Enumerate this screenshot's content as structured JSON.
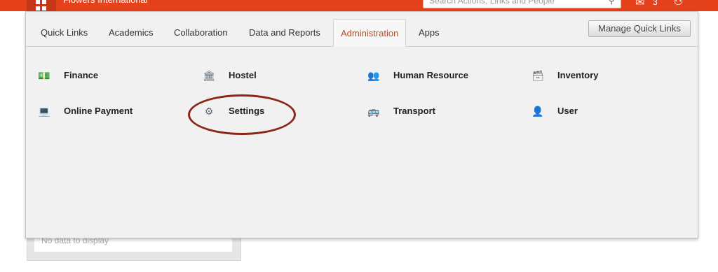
{
  "header": {
    "school_name": "Flowers International",
    "search_placeholder": "Search Actions, Links and People",
    "mail_count": "3",
    "search_icon": "search-icon",
    "mail_icon": "mail-icon",
    "user_icon": "user-icon"
  },
  "tabs": [
    {
      "label": "Quick Links"
    },
    {
      "label": "Academics"
    },
    {
      "label": "Collaboration"
    },
    {
      "label": "Data and Reports"
    },
    {
      "label": "Administration"
    },
    {
      "label": "Apps"
    }
  ],
  "active_tab": "Administration",
  "manage_label": "Manage Quick Links",
  "items": [
    {
      "label": "Finance",
      "icon": "finance-icon"
    },
    {
      "label": "Hostel",
      "icon": "hostel-icon"
    },
    {
      "label": "Human Resource",
      "icon": "human-resource-icon"
    },
    {
      "label": "Inventory",
      "icon": "inventory-icon"
    },
    {
      "label": "Online Payment",
      "icon": "online-payment-icon"
    },
    {
      "label": "Settings",
      "icon": "settings-icon"
    },
    {
      "label": "Transport",
      "icon": "transport-icon"
    },
    {
      "label": "User",
      "icon": "user-icon"
    }
  ],
  "background": {
    "empty_text": "No data to display"
  },
  "colors": {
    "topbar": "#e5411b",
    "active_tab": "#c0481f",
    "highlight": "#8c2618"
  }
}
